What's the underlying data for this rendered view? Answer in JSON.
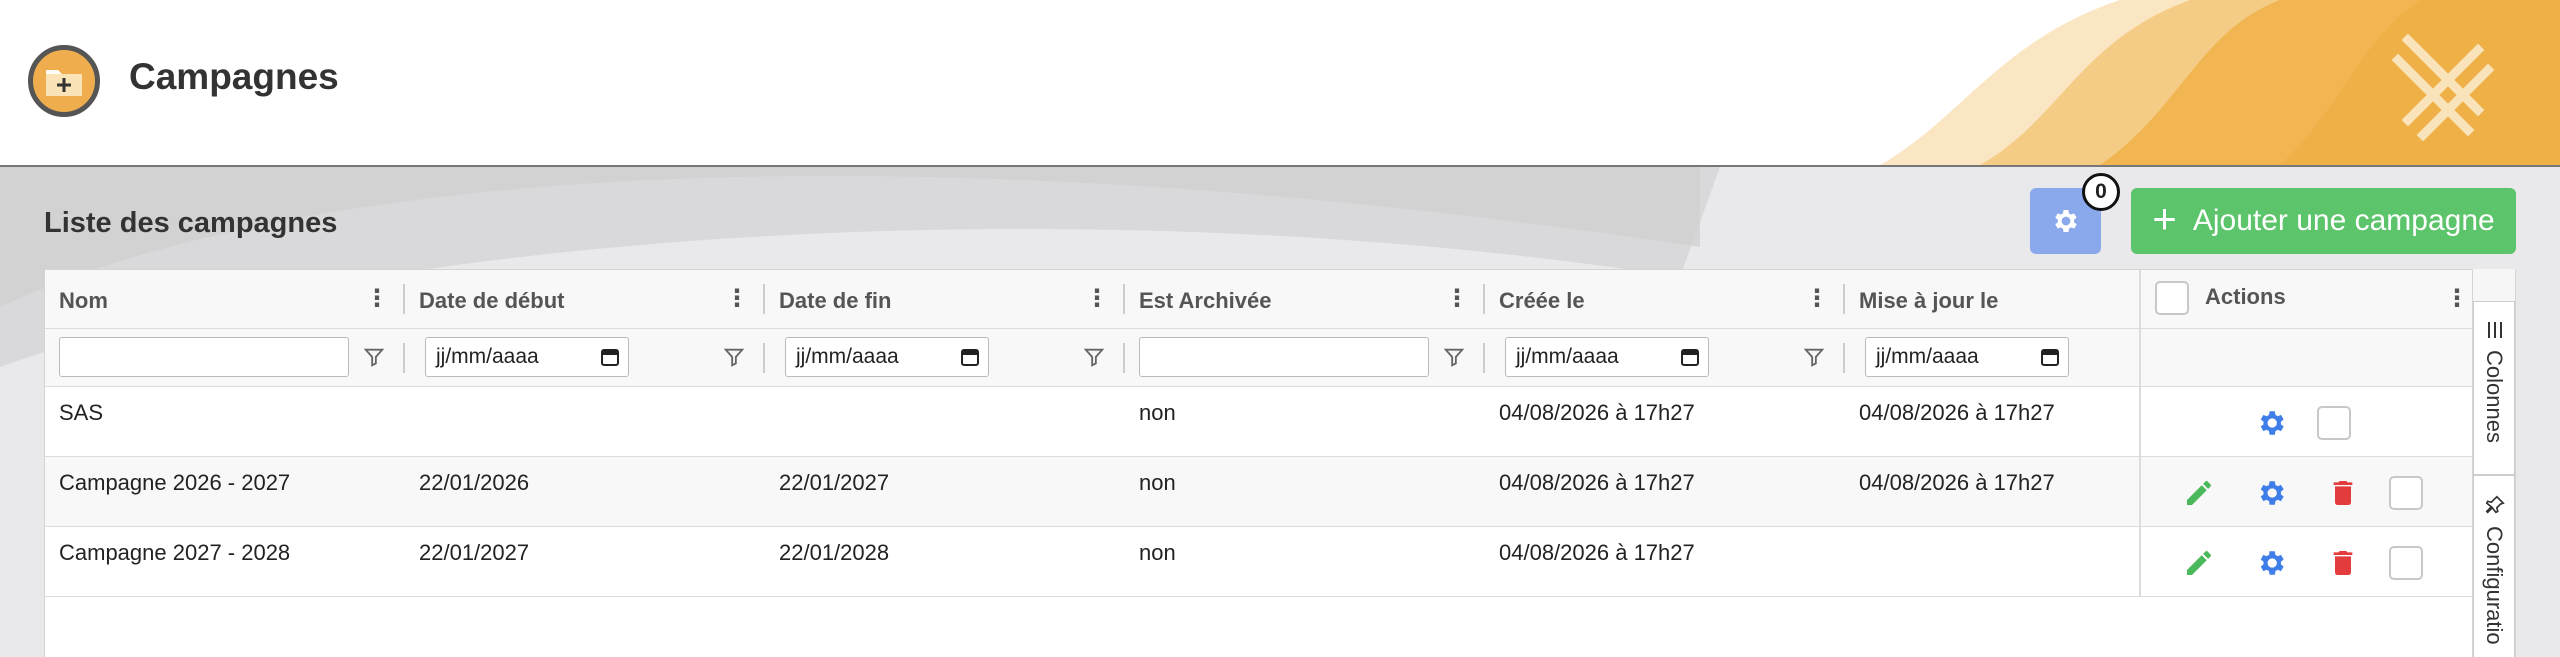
{
  "header": {
    "title": "Campagnes",
    "logo_icon": "folder-plus-icon",
    "brand_colors": {
      "orange": "#f0ad4e",
      "light": "#f9dca8"
    }
  },
  "toolbar": {
    "list_title": "Liste des campagnes",
    "settings_icon": "gear-icon",
    "badge_count": "0",
    "add_label": "Ajouter une campagne",
    "add_color": "#5cc46a",
    "settings_color": "#8aa8ec"
  },
  "table": {
    "columns": [
      {
        "label": "Nom"
      },
      {
        "label": "Date de début"
      },
      {
        "label": "Date de fin"
      },
      {
        "label": "Est Archivée"
      },
      {
        "label": "Créée le"
      },
      {
        "label": "Mise à jour le"
      },
      {
        "label": "Actions"
      }
    ],
    "filters": {
      "date_placeholder": "jj/mm/aaaa"
    },
    "rows": [
      {
        "nom": "SAS",
        "debut": "",
        "fin": "",
        "archivee": "non",
        "creee": "04/08/2026 à 17h27",
        "maj": "04/08/2026 à 17h27",
        "editable": false
      },
      {
        "nom": "Campagne 2026 - 2027",
        "debut": "22/01/2026",
        "fin": "22/01/2027",
        "archivee": "non",
        "creee": "04/08/2026 à 17h27",
        "maj": "04/08/2026 à 17h27",
        "editable": true
      },
      {
        "nom": "Campagne 2027 - 2028",
        "debut": "22/01/2027",
        "fin": "22/01/2028",
        "archivee": "non",
        "creee": "04/08/2026 à 17h27",
        "maj": "",
        "editable": true
      }
    ]
  },
  "side_panel": {
    "tabs": [
      {
        "label": "Colonnes",
        "icon": "columns-icon"
      },
      {
        "label": "Configuratio",
        "icon": "pin-icon"
      }
    ]
  }
}
